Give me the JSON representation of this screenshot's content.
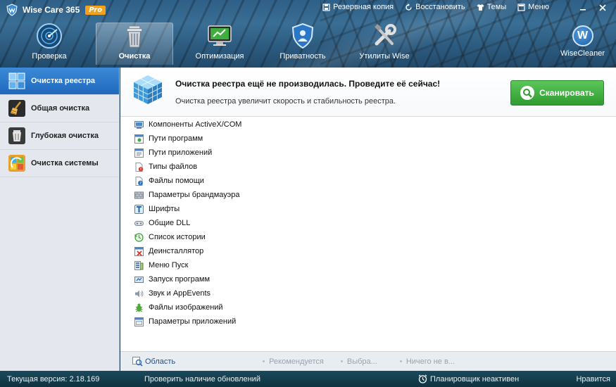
{
  "app": {
    "name": "Wise Care 365",
    "badge": "Pro"
  },
  "top_links": [
    {
      "label": "Резервная копия",
      "icon": "backup-icon"
    },
    {
      "label": "Восстановить",
      "icon": "restore-icon"
    },
    {
      "label": "Темы",
      "icon": "shirt-icon"
    },
    {
      "label": "Меню",
      "icon": "menu-icon"
    }
  ],
  "nav": [
    {
      "label": "Проверка",
      "icon": "radar-icon",
      "active": false
    },
    {
      "label": "Очистка",
      "icon": "trash-icon",
      "active": true
    },
    {
      "label": "Оптимизация",
      "icon": "monitor-icon",
      "active": false
    },
    {
      "label": "Приватность",
      "icon": "shield-icon",
      "active": false
    },
    {
      "label": "Утилиты Wise",
      "icon": "tools-icon",
      "active": false
    }
  ],
  "brand": {
    "letter": "W",
    "label": "WiseCleaner"
  },
  "sidebar": {
    "items": [
      {
        "label": "Очистка реестра",
        "icon": "registry-icon",
        "active": true
      },
      {
        "label": "Общая очистка",
        "icon": "broom-icon",
        "active": false
      },
      {
        "label": "Глубокая очистка",
        "icon": "deep-clean-icon",
        "active": false
      },
      {
        "label": "Очистка системы",
        "icon": "system-clean-icon",
        "active": false
      }
    ]
  },
  "banner": {
    "title": "Очистка реестра ещё не производилась. Проведите её сейчас!",
    "subtitle": "Очистка реестра увеличит скорость и стабильность реестра.",
    "scan_label": "Сканировать"
  },
  "items": [
    {
      "label": "Компоненты ActiveX/COM",
      "icon": "activex-icon"
    },
    {
      "label": "Пути программ",
      "icon": "program-paths-icon"
    },
    {
      "label": "Пути приложений",
      "icon": "app-paths-icon"
    },
    {
      "label": "Типы файлов",
      "icon": "file-types-icon"
    },
    {
      "label": "Файлы помощи",
      "icon": "help-files-icon"
    },
    {
      "label": "Параметры брандмауэра",
      "icon": "firewall-icon"
    },
    {
      "label": "Шрифты",
      "icon": "fonts-icon"
    },
    {
      "label": "Общие DLL",
      "icon": "dll-icon"
    },
    {
      "label": "Список истории",
      "icon": "history-icon"
    },
    {
      "label": "Деинсталлятор",
      "icon": "uninstaller-icon"
    },
    {
      "label": "Меню Пуск",
      "icon": "start-menu-icon"
    },
    {
      "label": "Запуск программ",
      "icon": "startup-icon"
    },
    {
      "label": "Звук и AppEvents",
      "icon": "sound-icon"
    },
    {
      "label": "Файлы изображений",
      "icon": "image-files-icon"
    },
    {
      "label": "Параметры приложений",
      "icon": "app-settings-icon"
    }
  ],
  "footer": {
    "area_label": "Область",
    "options": [
      "Рекомендуется",
      "Выбра...",
      "Ничего не в..."
    ]
  },
  "status": {
    "version": "Текущая версия: 2.18.169",
    "check_updates": "Проверить наличие обновлений",
    "scheduler": "Планировщик неактивен",
    "like": "Нравится"
  },
  "colors": {
    "accent": "#1f68bd",
    "scan_green": "#2f9b30",
    "pro_orange": "#f3a21b"
  }
}
